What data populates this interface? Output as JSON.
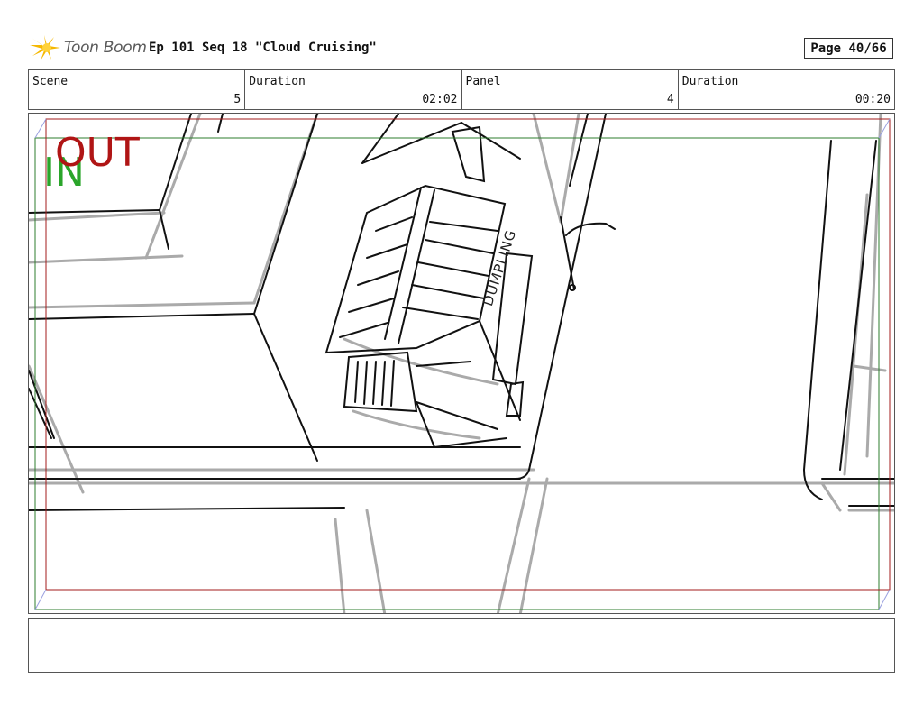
{
  "header": {
    "logo_text": "Toon Boom",
    "title": "Ep 101 Seq 18 \"Cloud Cruising\"",
    "page": "Page 40/66"
  },
  "info": {
    "scene_label": "Scene",
    "scene_value": "5",
    "duration_label": "Duration",
    "duration_value": "02:02",
    "panel_label": "Panel",
    "panel_value": "4",
    "panel_duration_label": "Duration",
    "panel_duration_value": "00:20"
  },
  "frame": {
    "in_label": "IN",
    "out_label": "OUT",
    "in_color": "#2aa52a",
    "out_color": "#b01515"
  },
  "sketch": {
    "sign_text": "DUMPLING"
  },
  "notes": {
    "text": ""
  }
}
